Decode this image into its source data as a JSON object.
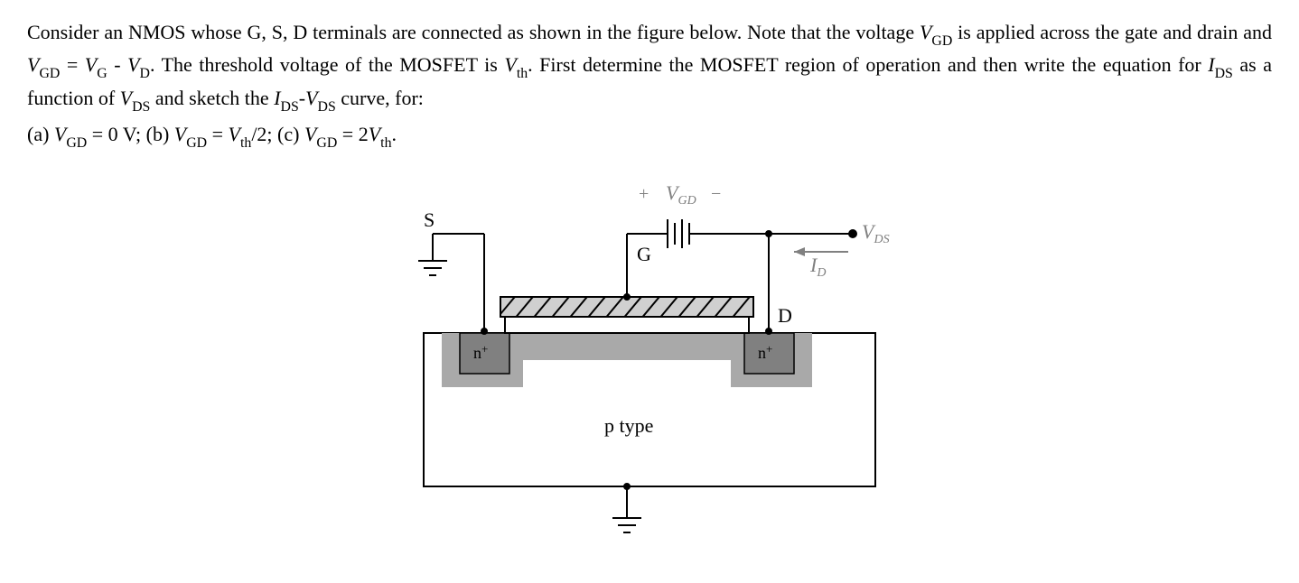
{
  "problem": {
    "line1_a": "Consider an NMOS whose G, S, D terminals are connected as shown in the figure below. Note that the voltage ",
    "vgd1": "V",
    "vgd1_sub": "GD",
    "line1_b": " is applied across the gate and drain and ",
    "vgd2": "V",
    "vgd2_sub": "GD",
    "line1_c": " = ",
    "vg": "V",
    "vg_sub": "G",
    "line1_d": " - ",
    "vd": "V",
    "vd_sub": "D",
    "line1_e": ". The threshold voltage of the MOSFET is ",
    "vth": "V",
    "vth_sub": "th",
    "line1_f": ". First determine the MOSFET region of operation and then write the equation for ",
    "ids1": "I",
    "ids1_sub": "DS",
    "line1_g": " as a function of ",
    "vds1": "V",
    "vds1_sub": "DS",
    "line1_h": " and sketch the ",
    "ids2": "I",
    "ids2_sub": "DS",
    "dash": "-",
    "vds2": "V",
    "vds2_sub": "DS",
    "line1_i": " curve, for:"
  },
  "parts": {
    "a_label": "(a) ",
    "a_var": "V",
    "a_sub": "GD",
    "a_val": " = 0 V; ",
    "b_label": "(b) ",
    "b_var": "V",
    "b_sub": "GD",
    "b_mid": " = ",
    "b_vth": "V",
    "b_vth_sub": "th",
    "b_val": "/2; ",
    "c_label": "(c) ",
    "c_var": "V",
    "c_sub": "GD",
    "c_mid": " = 2",
    "c_vth": "V",
    "c_vth_sub": "th",
    "c_end": "."
  },
  "figure": {
    "S": "S",
    "G": "G",
    "D": "D",
    "plus": "+",
    "VGD": "V",
    "VGD_sub": "GD",
    "minus": "−",
    "VDS": "V",
    "VDS_sub": "DS",
    "ID": "I",
    "ID_sub": "D",
    "nplus": "n",
    "nplus_sup": "+",
    "ptype": "p type"
  }
}
